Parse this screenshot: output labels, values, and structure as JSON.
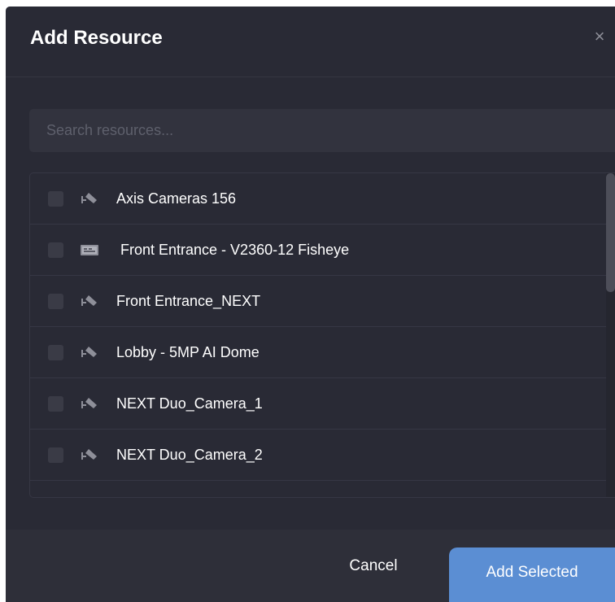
{
  "dialog": {
    "title": "Add Resource",
    "close_glyph": "×"
  },
  "search": {
    "placeholder": "Search resources...",
    "value": ""
  },
  "resources": [
    {
      "label": "Axis Cameras 156",
      "icon": "camera-icon",
      "checked": false
    },
    {
      "label": "Front Entrance - V2360-12 Fisheye",
      "icon": "fisheye-camera-icon",
      "checked": false
    },
    {
      "label": "Front Entrance_NEXT",
      "icon": "camera-icon",
      "checked": false
    },
    {
      "label": "Lobby - 5MP AI Dome",
      "icon": "camera-icon",
      "checked": false
    },
    {
      "label": "NEXT Duo_Camera_1",
      "icon": "camera-icon",
      "checked": false
    },
    {
      "label": "NEXT Duo_Camera_2",
      "icon": "camera-icon",
      "checked": false
    }
  ],
  "footer": {
    "cancel_label": "Cancel",
    "add_label": "Add Selected"
  },
  "colors": {
    "dialog_bg": "#292a35",
    "accent": "#5b8ed3",
    "text": "#ffffff",
    "muted_icon": "#8e8f99"
  }
}
